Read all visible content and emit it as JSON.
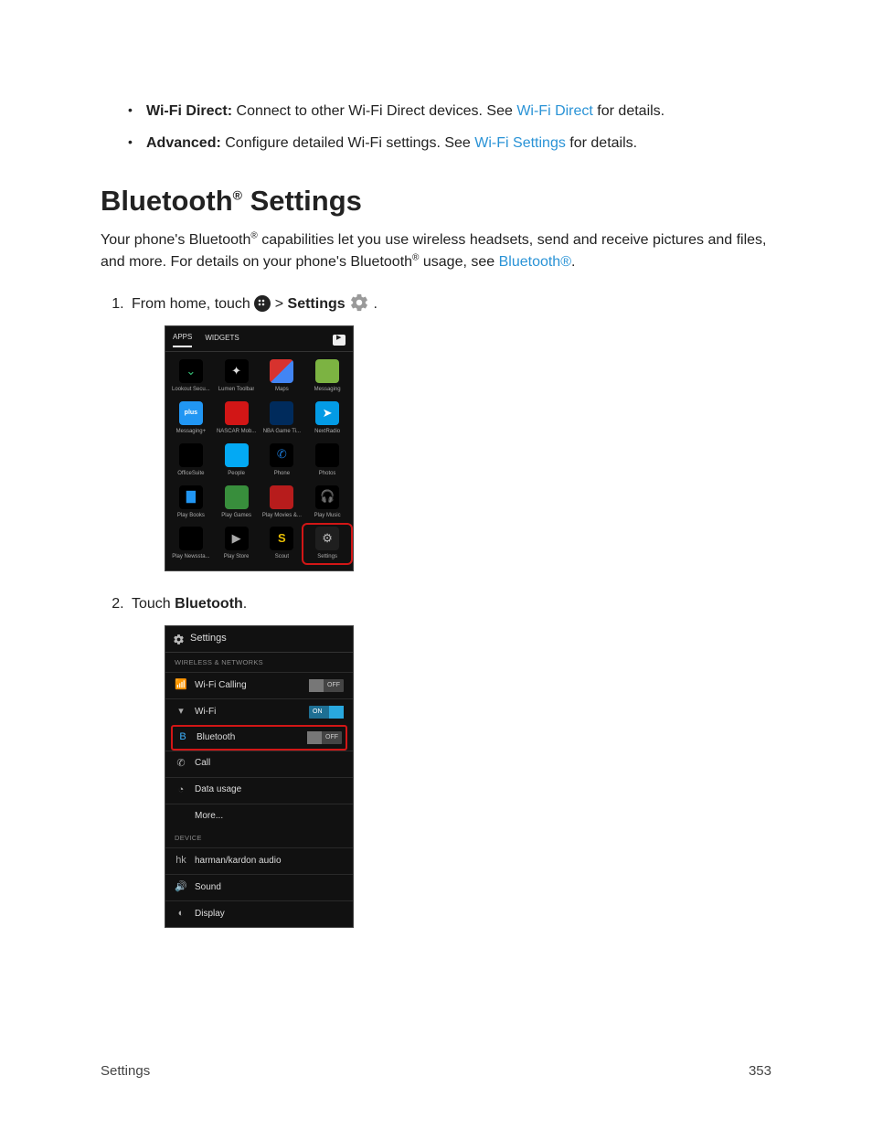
{
  "bullets": [
    {
      "strong": "Wi-Fi Direct:",
      "text_before_link": " Connect to other Wi-Fi Direct devices. See ",
      "link": "Wi-Fi Direct",
      "text_after_link": " for details."
    },
    {
      "strong": "Advanced:",
      "text_before_link": " Configure detailed Wi-Fi settings. See ",
      "link": "Wi-Fi Settings",
      "text_after_link": " for details."
    }
  ],
  "heading": {
    "part1": "Bluetooth",
    "sup": "®",
    "part2": " Settings"
  },
  "intro": {
    "t1": "Your phone's Bluetooth",
    "sup1": "®",
    "t2": " capabilities let you use wireless headsets, send and receive pictures and files, and more. For details on your phone's Bluetooth",
    "sup2": "®",
    "t3": " usage, see ",
    "link": "Bluetooth®",
    "t4": "."
  },
  "step1": {
    "before": "From home, touch ",
    "gt": " > ",
    "settings_label": "Settings",
    "dot": " ."
  },
  "drawer": {
    "tab_apps": "APPS",
    "tab_widgets": "WIDGETS",
    "apps": [
      {
        "cls": "lookout",
        "glyph": "⌄",
        "label": "Lookout Secu..."
      },
      {
        "cls": "lumen",
        "glyph": "✦",
        "label": "Lumen Toolbar"
      },
      {
        "cls": "maps",
        "glyph": "",
        "label": "Maps"
      },
      {
        "cls": "msg",
        "glyph": "",
        "label": "Messaging"
      },
      {
        "cls": "msgplus",
        "glyph": "plus",
        "label": "Messaging+"
      },
      {
        "cls": "nascar",
        "glyph": "",
        "label": "NASCAR Mob..."
      },
      {
        "cls": "nba",
        "glyph": "",
        "label": "NBA Game Ti..."
      },
      {
        "cls": "nextradio",
        "glyph": "➤",
        "label": "NextRadio"
      },
      {
        "cls": "office",
        "glyph": "",
        "label": "OfficeSuite"
      },
      {
        "cls": "people",
        "glyph": "",
        "label": "People"
      },
      {
        "cls": "phone",
        "glyph": "✆",
        "label": "Phone"
      },
      {
        "cls": "photos",
        "glyph": "",
        "label": "Photos"
      },
      {
        "cls": "playbooks",
        "glyph": "▇",
        "label": "Play Books"
      },
      {
        "cls": "playgames",
        "glyph": "",
        "label": "Play Games"
      },
      {
        "cls": "playmovies",
        "glyph": "",
        "label": "Play Movies &..."
      },
      {
        "cls": "playmusic",
        "glyph": "🎧",
        "label": "Play Music"
      },
      {
        "cls": "playnews",
        "glyph": "",
        "label": "Play Newssta..."
      },
      {
        "cls": "playstore",
        "glyph": "▶",
        "label": "Play Store"
      },
      {
        "cls": "scout",
        "glyph": "S",
        "label": "Scout"
      },
      {
        "cls": "settings-app",
        "glyph": "⚙",
        "label": "Settings",
        "highlight": true
      }
    ]
  },
  "step2": {
    "before": "Touch ",
    "bold": "Bluetooth",
    "after": "."
  },
  "settings_screen": {
    "title": "Settings",
    "group_wireless": "WIRELESS & NETWORKS",
    "group_device": "DEVICE",
    "toggle_off": "OFF",
    "toggle_on": "ON",
    "rows_wireless": [
      {
        "icon": "📶",
        "label": "Wi-Fi Calling",
        "toggle": "off"
      },
      {
        "icon": "▾",
        "label": "Wi-Fi",
        "toggle": "on"
      },
      {
        "icon": "B",
        "iconClass": "bt",
        "label": "Bluetooth",
        "toggle": "off",
        "highlight": true
      },
      {
        "icon": "✆",
        "label": "Call"
      },
      {
        "icon": "◔",
        "label": "Data usage"
      },
      {
        "icon": "",
        "label": "More..."
      }
    ],
    "rows_device": [
      {
        "icon": "hk",
        "label": "harman/kardon audio"
      },
      {
        "icon": "🔊",
        "label": "Sound"
      },
      {
        "icon": "◐",
        "label": "Display"
      }
    ]
  },
  "footer": {
    "left": "Settings",
    "right": "353"
  }
}
